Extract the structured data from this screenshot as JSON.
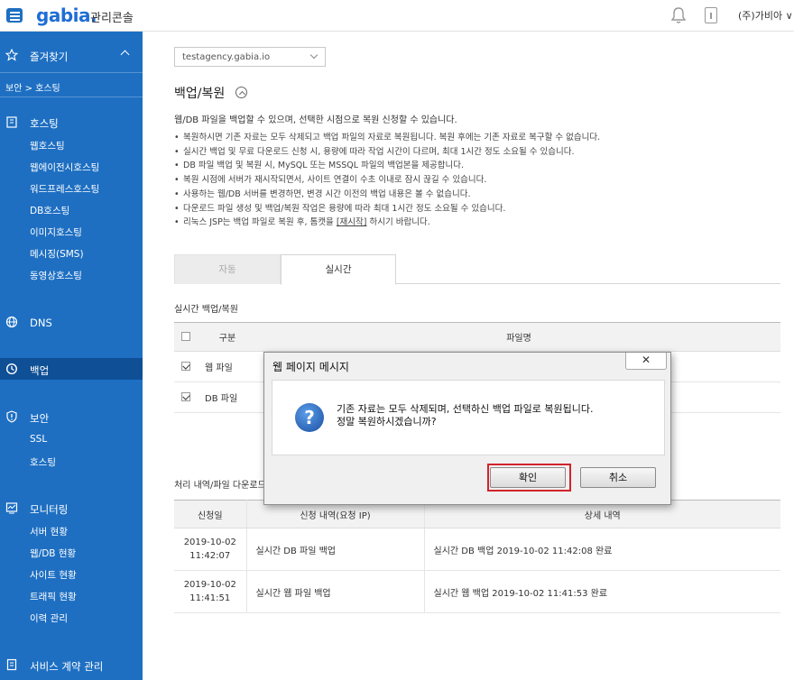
{
  "header": {
    "logo": "gabia.",
    "console": "관리콘솔",
    "user": "(주)가비아"
  },
  "sidebar": {
    "favorites": "즐겨찾기",
    "breadcrumb": "보안 > 호스팅",
    "hosting": {
      "label": "호스팅",
      "items": [
        "웹호스팅",
        "웹에이전시호스팅",
        "워드프레스호스팅",
        "DB호스팅",
        "이미지호스팅",
        "메시징(SMS)",
        "동영상호스팅"
      ]
    },
    "dns": "DNS",
    "backup": "백업",
    "security": {
      "label": "보안",
      "items": [
        "SSL",
        "호스팅"
      ]
    },
    "monitoring": {
      "label": "모니터링",
      "items": [
        "서버 현황",
        "웹/DB 현황",
        "사이트 현황",
        "트래픽 현황",
        "이력 관리"
      ]
    },
    "contract": "서비스 계약 관리"
  },
  "main": {
    "select_value": "testagency.gabia.io",
    "title": "백업/복원",
    "intro": "웹/DB 파일을 백업할 수 있으며, 선택한 시점으로 복원 신청할 수 있습니다.",
    "bullets": [
      "복원하시면 기존 자료는 모두 삭제되고 백업 파일의 자료로 복원됩니다. 복원 후에는 기존 자료로 복구할 수 없습니다.",
      "실시간 백업 및 무료 다운로드 신청 시, 용량에 따라 작업 시간이 다르며, 최대 1시간 정도 소요될 수 있습니다.",
      "DB 파일 백업 및 복원 시, MySQL 또는 MSSQL 파일의 백업본을 제공합니다.",
      "복원 시점에 서버가 재시작되면서, 사이트 연결이 수초 이내로 잠시 끊길 수 있습니다.",
      "사용하는 웹/DB 서버를 변경하면, 변경 시간 이전의 백업 내용은 볼 수 없습니다.",
      "다운로드 파일 생성 및 백업/복원 작업은 용량에 따라 최대 1시간 정도 소요될 수 있습니다."
    ],
    "last_bullet_pre": "리눅스 JSP는 백업 파일로 복원 후, 톰캣을 ",
    "last_bullet_link": "[재시작]",
    "last_bullet_post": " 하시기 바랍니다.",
    "tabs": {
      "auto": "자동",
      "realtime": "실시간"
    },
    "section_realtime": "실시간 백업/복원",
    "table1": {
      "col_type": "구분",
      "col_file": "파일명",
      "rows": [
        {
          "type": "웹 파일"
        },
        {
          "type": "DB 파일"
        }
      ]
    },
    "section_history": "처리 내역/파일 다운로드",
    "table2": {
      "headers": [
        "신청일",
        "신청 내역(요청 IP)",
        "상세 내역"
      ],
      "rows": [
        {
          "date": "2019-10-02",
          "time": "11:42:07",
          "request": "실시간 DB 파일 백업",
          "detail": "실시간 DB 백업 2019-10-02 11:42:08 완료"
        },
        {
          "date": "2019-10-02",
          "time": "11:41:51",
          "request": "실시간 웹 파일 백업",
          "detail": "실시간 웹 백업 2019-10-02 11:41:53 완료"
        }
      ]
    }
  },
  "dialog": {
    "title": "웹 페이지 메시지",
    "message_line1": "기존 자료는 모두 삭제되며, 선택하신 백업 파일로 복원됩니다.",
    "message_line2": "정말 복원하시겠습니까?",
    "ok": "확인",
    "cancel": "취소",
    "close": "✕"
  }
}
